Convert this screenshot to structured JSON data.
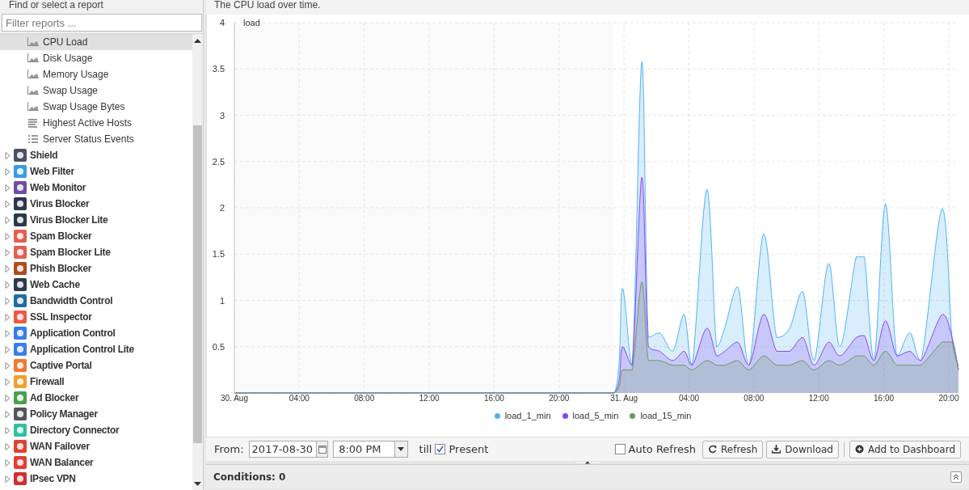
{
  "sidebar": {
    "title": "Find or select a report",
    "filter": {
      "placeholder": "Filter reports ..."
    },
    "items": [
      {
        "label": "CPU Load",
        "kind": "area",
        "selected": true
      },
      {
        "label": "Disk Usage",
        "kind": "area",
        "selected": false
      },
      {
        "label": "Memory Usage",
        "kind": "area",
        "selected": false
      },
      {
        "label": "Swap Usage",
        "kind": "area",
        "selected": false
      },
      {
        "label": "Swap Usage Bytes",
        "kind": "area",
        "selected": false
      },
      {
        "label": "Highest Active Hosts",
        "kind": "bars",
        "selected": false
      },
      {
        "label": "Server Status Events",
        "kind": "list",
        "selected": false
      },
      {
        "label": "Shield",
        "kind": "app",
        "color": "#4a5162",
        "selected": false,
        "expanded": false
      },
      {
        "label": "Web Filter",
        "kind": "app",
        "color": "#3b9de0",
        "selected": false,
        "expanded": false
      },
      {
        "label": "Web Monitor",
        "kind": "app",
        "color": "#6b4fa0",
        "selected": false,
        "expanded": false
      },
      {
        "label": "Virus Blocker",
        "kind": "app",
        "color": "#2b3848",
        "selected": false,
        "expanded": false
      },
      {
        "label": "Virus Blocker Lite",
        "kind": "app",
        "color": "#2b3849",
        "selected": false,
        "expanded": false
      },
      {
        "label": "Spam Blocker",
        "kind": "app",
        "color": "#e06050",
        "selected": false,
        "expanded": false
      },
      {
        "label": "Spam Blocker Lite",
        "kind": "app",
        "color": "#e06051",
        "selected": false,
        "expanded": false
      },
      {
        "label": "Phish Blocker",
        "kind": "app",
        "color": "#b04a20",
        "selected": false,
        "expanded": false
      },
      {
        "label": "Web Cache",
        "kind": "app",
        "color": "#2d3a4a",
        "selected": false,
        "expanded": false
      },
      {
        "label": "Bandwidth Control",
        "kind": "app",
        "color": "#1e6ea0",
        "selected": false,
        "expanded": false
      },
      {
        "label": "SSL Inspector",
        "kind": "app",
        "color": "#f05a40",
        "selected": false,
        "expanded": false
      },
      {
        "label": "Application Control",
        "kind": "app",
        "color": "#3a7de8",
        "selected": false,
        "expanded": false
      },
      {
        "label": "Application Control Lite",
        "kind": "app",
        "color": "#3a7de9",
        "selected": false,
        "expanded": false
      },
      {
        "label": "Captive Portal",
        "kind": "app",
        "color": "#f07a30",
        "selected": false,
        "expanded": false
      },
      {
        "label": "Firewall",
        "kind": "app",
        "color": "#f0a030",
        "selected": false,
        "expanded": false
      },
      {
        "label": "Ad Blocker",
        "kind": "app",
        "color": "#4aa050",
        "selected": false,
        "expanded": false
      },
      {
        "label": "Policy Manager",
        "kind": "app",
        "color": "#555555",
        "selected": false,
        "expanded": false
      },
      {
        "label": "Directory Connector",
        "kind": "app",
        "color": "#30c0a0",
        "selected": false,
        "expanded": false
      },
      {
        "label": "WAN Failover",
        "kind": "app",
        "color": "#e04030",
        "selected": false,
        "expanded": false
      },
      {
        "label": "WAN Balancer",
        "kind": "app",
        "color": "#e04031",
        "selected": false,
        "expanded": false
      },
      {
        "label": "IPsec VPN",
        "kind": "app",
        "color": "#d03030",
        "selected": false,
        "expanded": false
      }
    ]
  },
  "report": {
    "description": "The CPU load over time.",
    "chart_data": {
      "type": "area",
      "ylabel": "load",
      "grid": true,
      "legend": true,
      "xlim": [
        "2017-08-30T00:00",
        "2017-08-31T20:36"
      ],
      "ylim": [
        0,
        4
      ],
      "x": [
        "2017-08-30T00:00",
        "2017-08-30T23:24",
        "2017-08-30T23:54",
        "2017-08-31T00:30",
        "2017-08-31T01:06",
        "2017-08-31T01:30",
        "2017-08-31T02:12",
        "2017-08-31T03:00",
        "2017-08-31T03:42",
        "2017-08-31T04:12",
        "2017-08-31T05:06",
        "2017-08-31T05:42",
        "2017-08-31T06:12",
        "2017-08-31T07:00",
        "2017-08-31T07:42",
        "2017-08-31T08:36",
        "2017-08-31T09:24",
        "2017-08-31T10:12",
        "2017-08-31T11:00",
        "2017-08-31T11:42",
        "2017-08-31T12:36",
        "2017-08-31T13:18",
        "2017-08-31T14:18",
        "2017-08-31T14:48",
        "2017-08-31T15:24",
        "2017-08-31T16:06",
        "2017-08-31T16:48",
        "2017-08-31T17:36",
        "2017-08-31T18:18",
        "2017-08-31T19:36",
        "2017-08-31T20:12",
        "2017-08-31T20:36"
      ],
      "series": [
        {
          "name": "load_1_min",
          "color": "#4fb3f6",
          "values": [
            0,
            0,
            1.13,
            0.3,
            3.58,
            0.6,
            0.65,
            0.45,
            0.85,
            0.3,
            2.2,
            0.5,
            0.7,
            1.15,
            0.3,
            1.72,
            0.6,
            0.7,
            1.1,
            0.35,
            1.4,
            0.5,
            1.47,
            1.47,
            0.35,
            2.04,
            0.4,
            0.65,
            0.35,
            1.99,
            0.6,
            0.3
          ]
        },
        {
          "name": "load_5_min",
          "color": "#8e44f0",
          "values": [
            0,
            0,
            0.5,
            0.3,
            2.33,
            0.5,
            0.45,
            0.35,
            0.45,
            0.3,
            0.7,
            0.4,
            0.45,
            0.55,
            0.3,
            0.85,
            0.45,
            0.45,
            0.6,
            0.3,
            0.55,
            0.4,
            0.6,
            0.62,
            0.35,
            0.78,
            0.4,
            0.45,
            0.35,
            0.85,
            0.6,
            0.25
          ]
        },
        {
          "name": "load_15_min",
          "color": "#6a9a5b",
          "values": [
            0,
            0,
            0.25,
            0.25,
            1.2,
            0.35,
            0.35,
            0.3,
            0.3,
            0.25,
            0.35,
            0.3,
            0.3,
            0.35,
            0.25,
            0.4,
            0.3,
            0.3,
            0.35,
            0.25,
            0.35,
            0.3,
            0.4,
            0.4,
            0.3,
            0.45,
            0.3,
            0.3,
            0.3,
            0.55,
            0.55,
            0.25
          ]
        }
      ],
      "xticks": [
        {
          "value": "2017-08-30T00:00",
          "label": "30. Aug"
        },
        {
          "value": "2017-08-30T04:00",
          "label": "04:00"
        },
        {
          "value": "2017-08-30T08:00",
          "label": "08:00"
        },
        {
          "value": "2017-08-30T12:00",
          "label": "12:00"
        },
        {
          "value": "2017-08-30T16:00",
          "label": "16:00"
        },
        {
          "value": "2017-08-30T20:00",
          "label": "20:00"
        },
        {
          "value": "2017-08-31T00:00",
          "label": "31. Aug"
        },
        {
          "value": "2017-08-31T04:00",
          "label": "04:00"
        },
        {
          "value": "2017-08-31T08:00",
          "label": "08:00"
        },
        {
          "value": "2017-08-31T12:00",
          "label": "12:00"
        },
        {
          "value": "2017-08-31T16:00",
          "label": "16:00"
        },
        {
          "value": "2017-08-31T20:00",
          "label": "20:00"
        }
      ],
      "yticks": [
        0.5,
        1,
        1.5,
        2,
        2.5,
        3,
        3.5,
        4
      ]
    }
  },
  "toolbar": {
    "from_label": "From:",
    "date": "2017-08-30",
    "time": "8:00 PM",
    "till_label": "till",
    "present": {
      "label": "Present",
      "checked": true
    },
    "auto_refresh": {
      "label": "Auto Refresh",
      "checked": false
    },
    "buttons": [
      {
        "label": "Refresh",
        "kind": "refresh"
      },
      {
        "label": "Download",
        "kind": "download"
      },
      {
        "label": "Add to Dashboard",
        "kind": "add"
      }
    ]
  },
  "conditions": {
    "label": "Conditions: 0"
  }
}
